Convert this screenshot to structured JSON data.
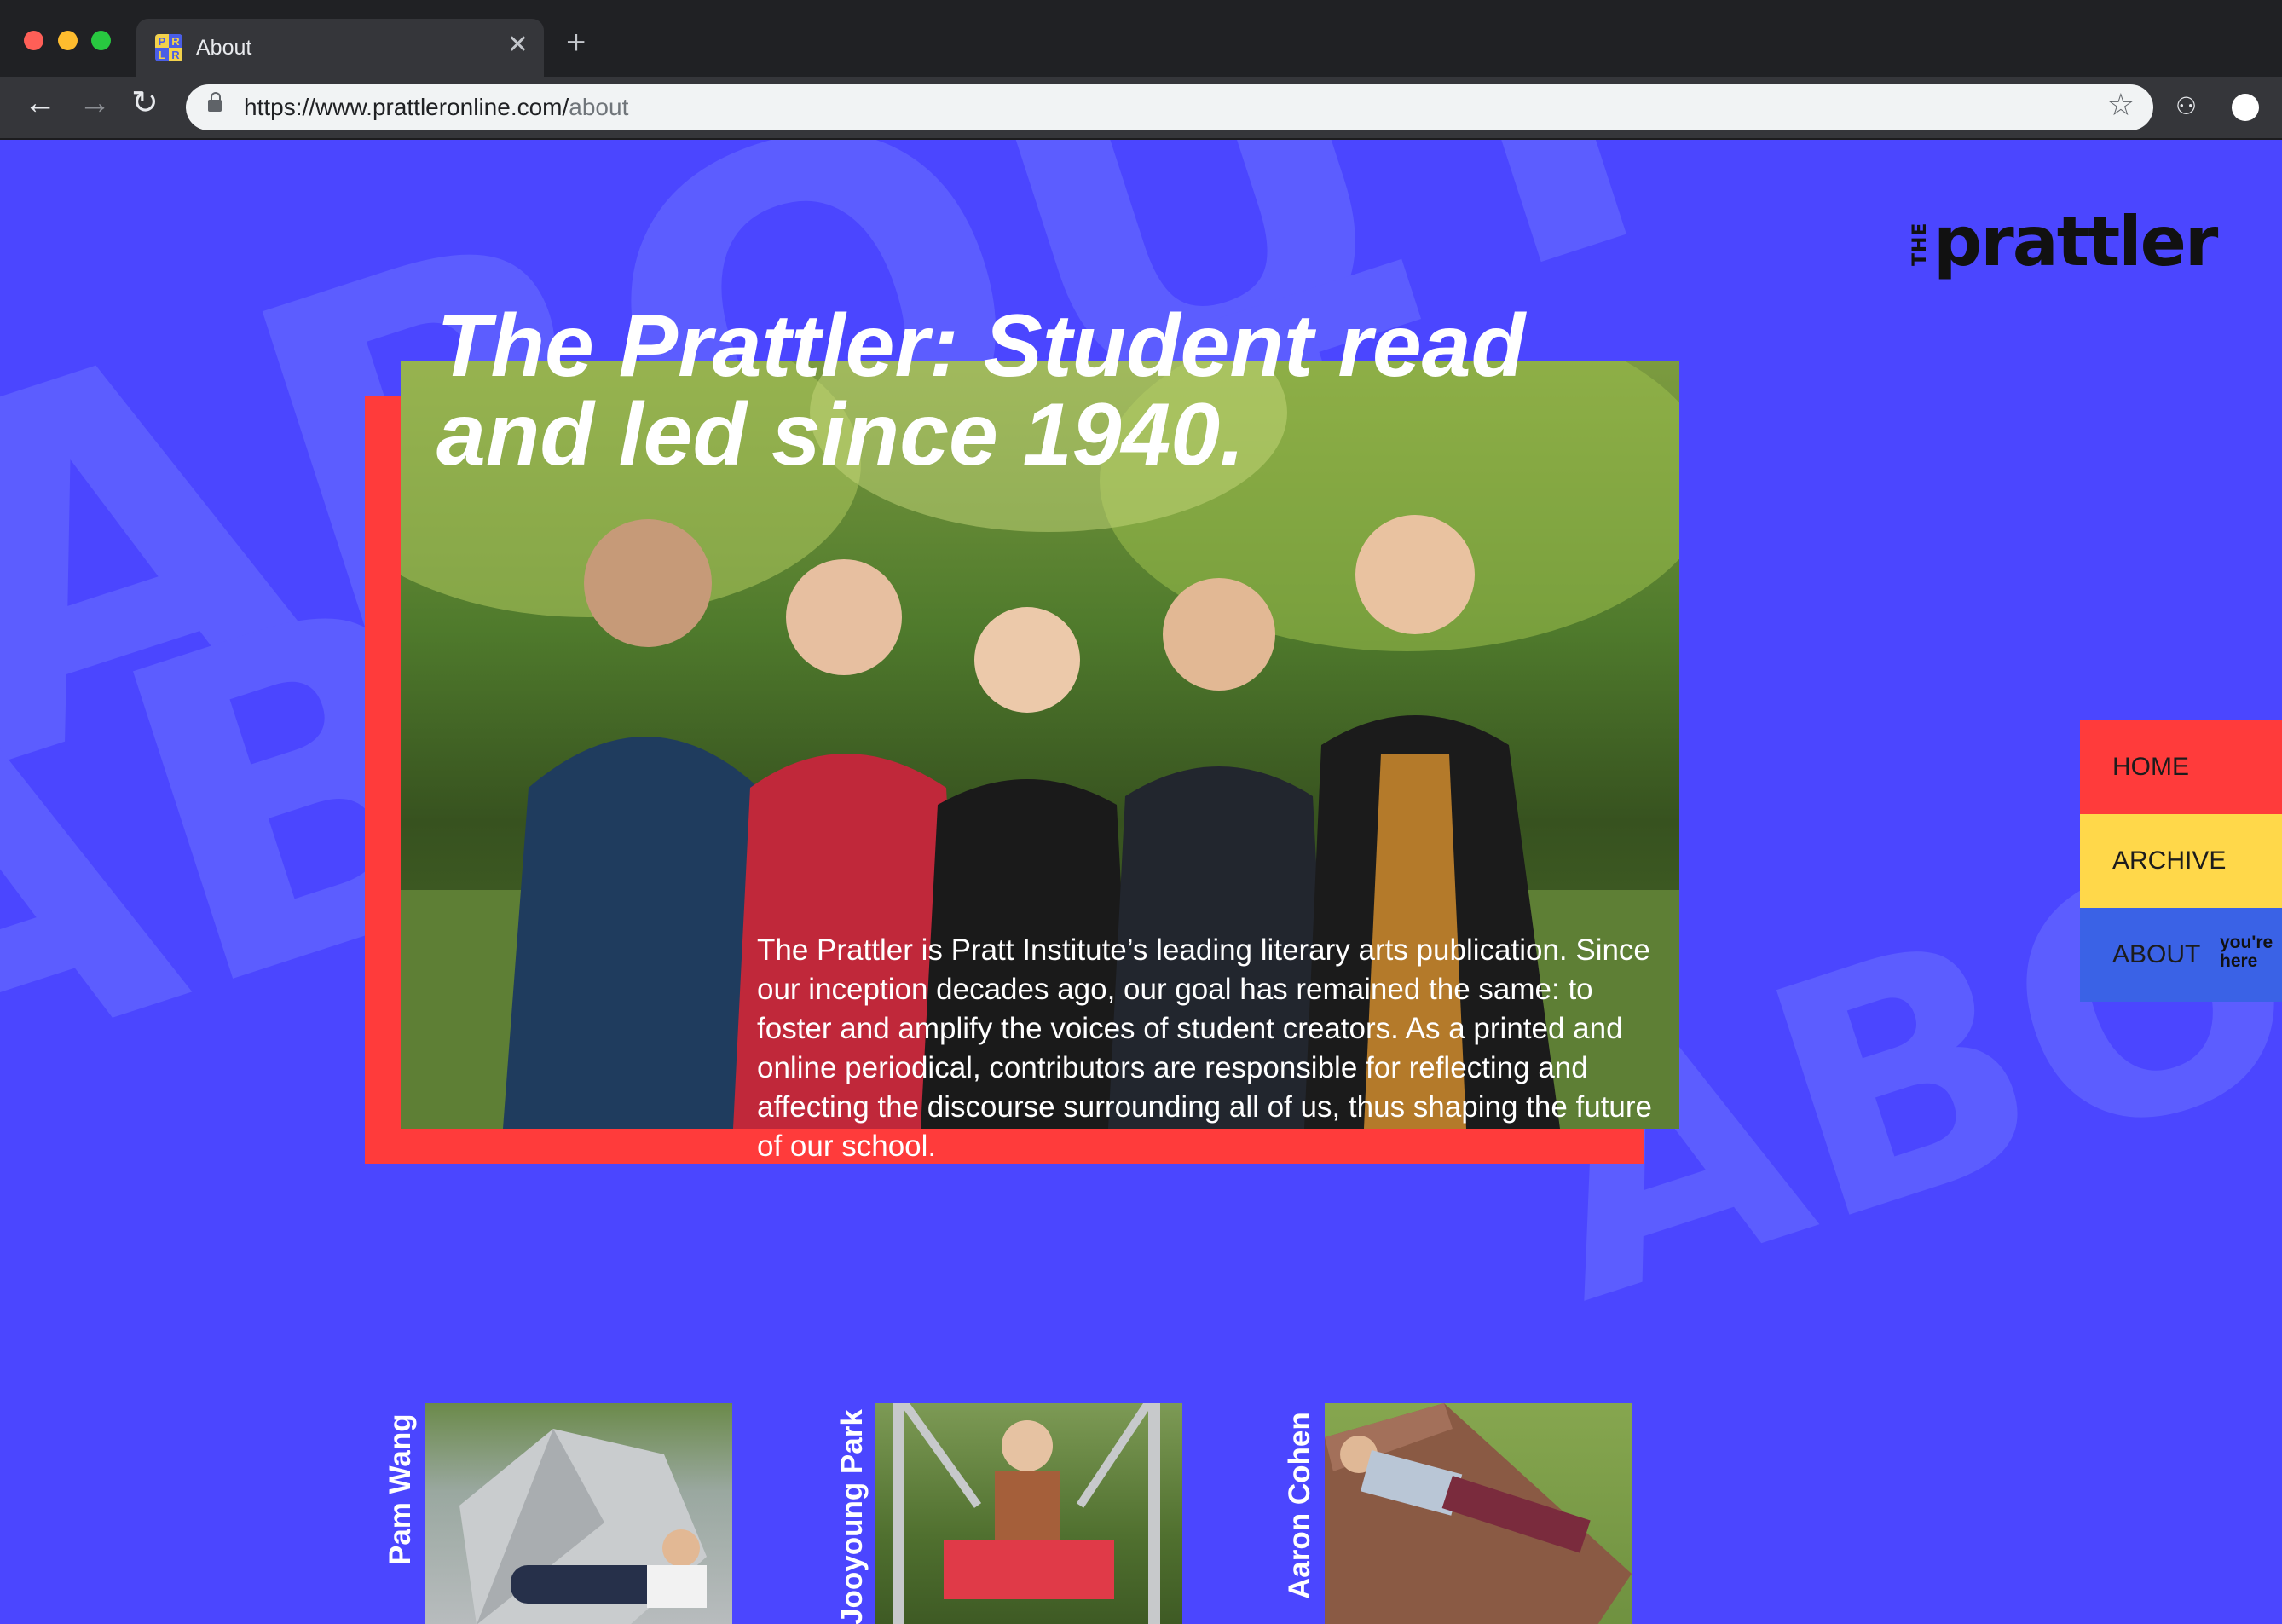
{
  "browser": {
    "tab_title": "About",
    "favicon_letters": [
      "P",
      "R",
      "L",
      "R"
    ],
    "close_glyph": "✕",
    "new_tab_glyph": "+",
    "url_base": "https://www.prattleronline.com/",
    "url_path": "about",
    "icons": {
      "back": "←",
      "forward": "→",
      "reload": "↻",
      "star": "☆",
      "incognito": "⚇"
    }
  },
  "logo": {
    "prefix": "THE",
    "word": "prattler"
  },
  "background_letters": [
    "ABOUT",
    "ABOUT",
    "ABOUT"
  ],
  "hero": {
    "title": "The Prattler: Student read and led since 1940.",
    "description": "The Prattler is Pratt Institute’s leading literary arts publication. Since our inception decades ago, our goal has remained the same: to foster and amplify the voices of student creators. As a printed and online periodical, contributors are responsible for reflecting and affecting the discourse surrounding all of us, thus shaping the future of our school."
  },
  "nav": {
    "items": [
      {
        "label": "HOME",
        "color": "#ff3b3b"
      },
      {
        "label": "ARCHIVE",
        "color": "#ffd84a"
      },
      {
        "label": "ABOUT",
        "color": "#3a62e6"
      }
    ],
    "current_marker": "you're here"
  },
  "team": [
    {
      "name": "Pam Wang"
    },
    {
      "name": "Jooyoung Park"
    },
    {
      "name": "Aaron Cohen"
    }
  ],
  "colors": {
    "page_bg": "#4b46ff",
    "accent_red": "#ff3b3b",
    "accent_yellow": "#ffd84a",
    "accent_blue": "#3a62e6"
  }
}
